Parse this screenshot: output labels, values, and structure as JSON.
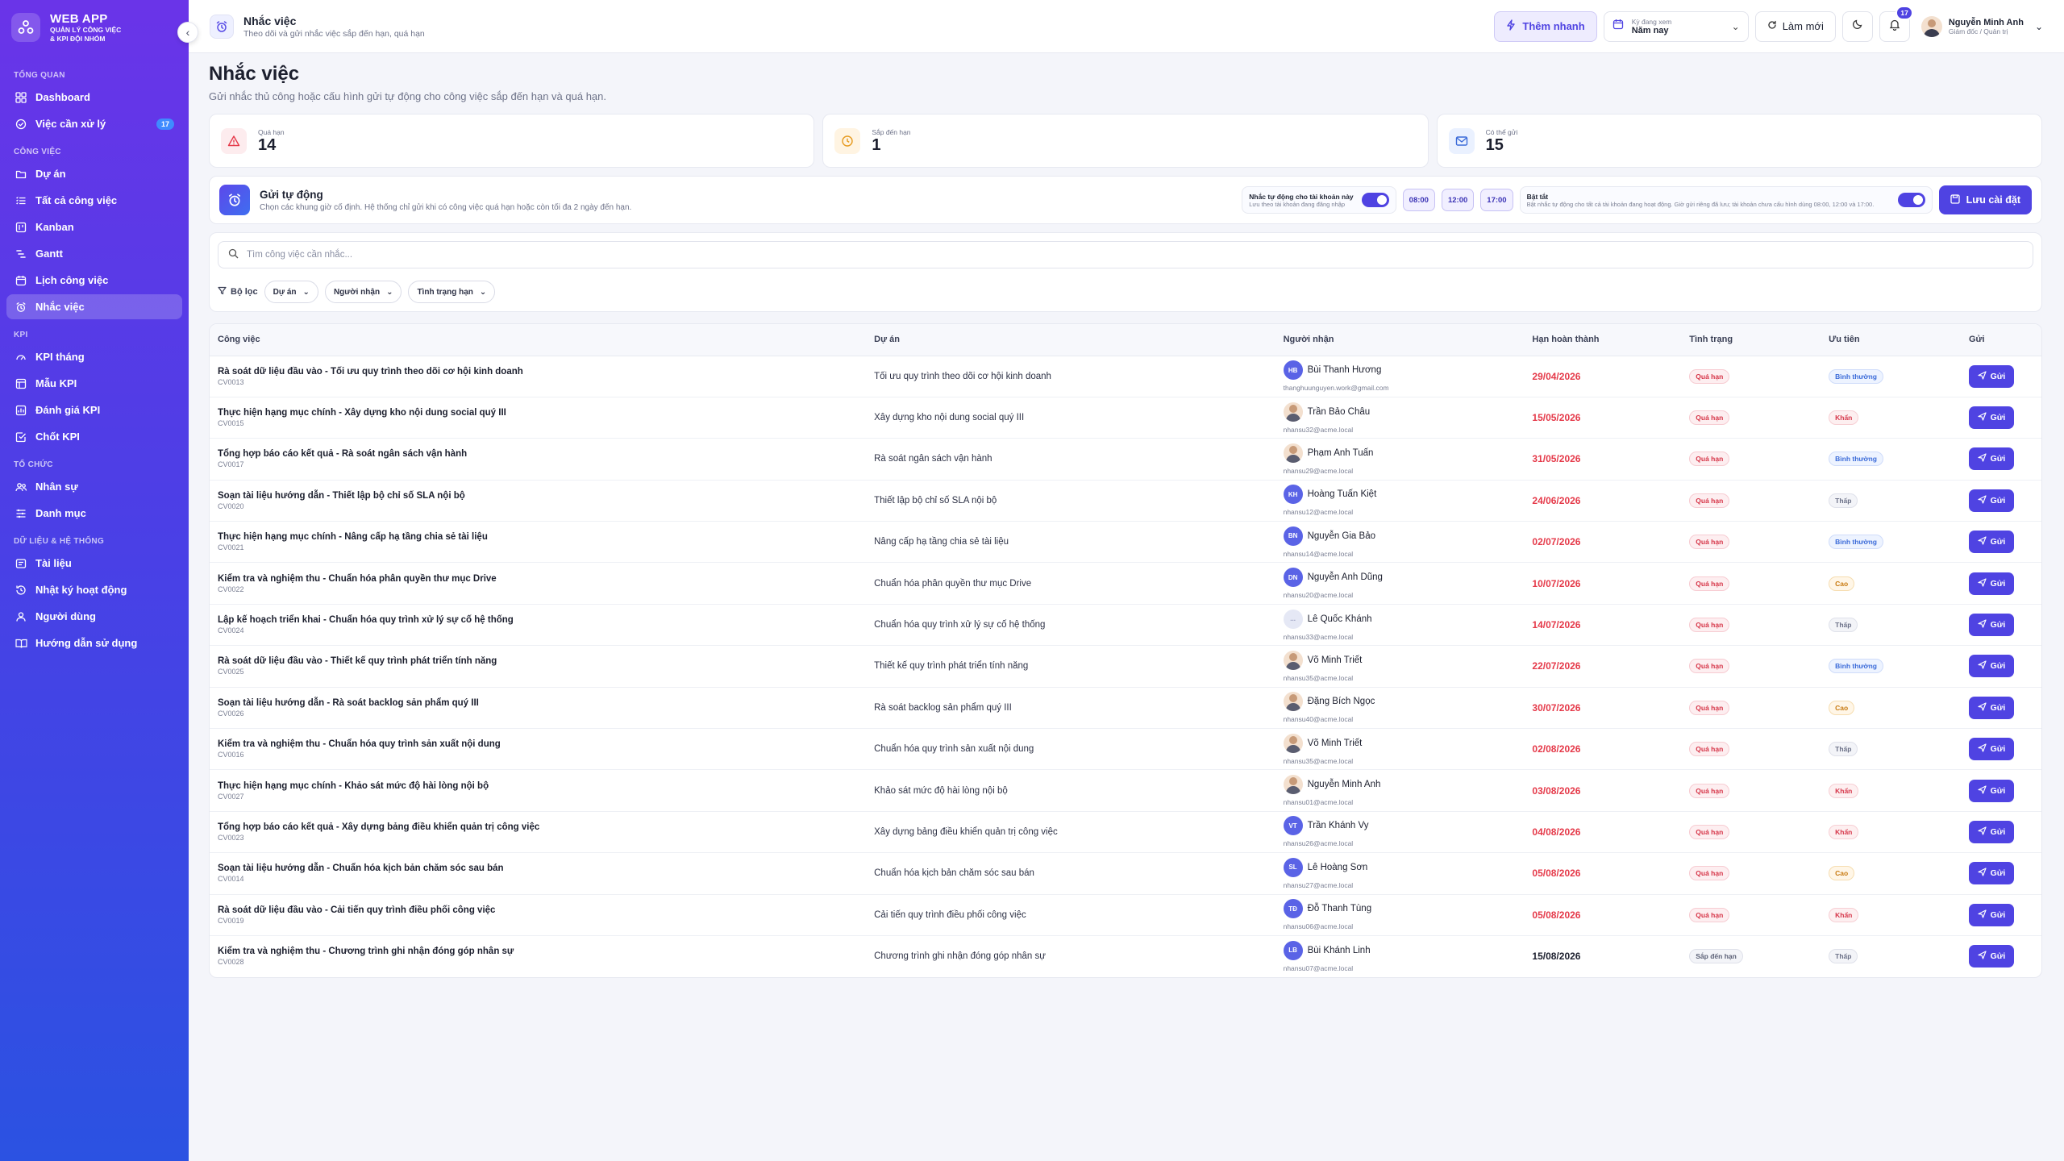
{
  "brand": {
    "title": "WEB APP",
    "subtitle_line1": "QUẢN LÝ CÔNG VIỆC",
    "subtitle_line2": "& KPI ĐỘI NHÓM"
  },
  "sidebar": {
    "sections": [
      {
        "title": "TỔNG QUAN",
        "items": [
          {
            "label": "Dashboard",
            "icon": "dashboard-icon"
          },
          {
            "label": "Việc cần xử lý",
            "icon": "check-circle-icon",
            "badge": "17"
          }
        ]
      },
      {
        "title": "CÔNG VIỆC",
        "items": [
          {
            "label": "Dự án",
            "icon": "folder-icon"
          },
          {
            "label": "Tất cả công việc",
            "icon": "list-icon"
          },
          {
            "label": "Kanban",
            "icon": "kanban-icon"
          },
          {
            "label": "Gantt",
            "icon": "gantt-icon"
          },
          {
            "label": "Lịch công việc",
            "icon": "calendar-icon"
          },
          {
            "label": "Nhắc việc",
            "icon": "alarm-icon",
            "active": true
          }
        ]
      },
      {
        "title": "KPI",
        "items": [
          {
            "label": "KPI tháng",
            "icon": "gauge-icon"
          },
          {
            "label": "Mẫu KPI",
            "icon": "template-icon"
          },
          {
            "label": "Đánh giá KPI",
            "icon": "rating-icon"
          },
          {
            "label": "Chốt KPI",
            "icon": "check-square-icon"
          }
        ]
      },
      {
        "title": "TỔ CHỨC",
        "items": [
          {
            "label": "Nhân sự",
            "icon": "users-icon"
          },
          {
            "label": "Danh mục",
            "icon": "category-icon"
          }
        ]
      },
      {
        "title": "DỮ LIỆU & HỆ THỐNG",
        "items": [
          {
            "label": "Tài liệu",
            "icon": "document-icon"
          },
          {
            "label": "Nhật ký hoạt động",
            "icon": "history-icon"
          },
          {
            "label": "Người dùng",
            "icon": "user-icon"
          },
          {
            "label": "Hướng dẫn sử dụng",
            "icon": "book-icon"
          }
        ]
      }
    ]
  },
  "topbar": {
    "title": "Nhắc việc",
    "subtitle": "Theo dõi và gửi nhắc việc sắp đến hạn, quá hạn",
    "quick_add": "Thêm nhanh",
    "period_label": "Kỳ đang xem",
    "period_value": "Năm nay",
    "refresh": "Làm mới",
    "notif_count": "17",
    "user_name": "Nguyễn Minh Anh",
    "user_role": "Giám đốc / Quản trị"
  },
  "page": {
    "title": "Nhắc việc",
    "subtitle": "Gửi nhắc thủ công hoặc cấu hình gửi tự động cho công việc sắp đến hạn và quá hạn."
  },
  "stats": [
    {
      "label": "Quá hạn",
      "value": "14",
      "icon": "warning-icon",
      "color": "#e53949",
      "bg": "#fdecee"
    },
    {
      "label": "Sắp đến hạn",
      "value": "1",
      "icon": "clock-icon",
      "color": "#e69a1e",
      "bg": "#fff4e2"
    },
    {
      "label": "Có thể gửi",
      "value": "15",
      "icon": "mail-icon",
      "color": "#3b6bd9",
      "bg": "#eaf1ff"
    }
  ],
  "auto_send": {
    "title": "Gửi tự động",
    "desc": "Chọn các khung giờ cố định. Hệ thống chỉ gửi khi có công việc quá hạn hoặc còn tối đa 2 ngày đến hạn.",
    "account_toggle_title": "Nhắc tự động cho tài khoản này",
    "account_toggle_desc": "Lưu theo tài khoản đang đăng nhập",
    "times": [
      "08:00",
      "12:00",
      "17:00"
    ],
    "global_toggle_title": "Bật tắt",
    "global_toggle_desc": "Bật nhắc tự động cho tất cả tài khoản đang hoạt động. Giờ gửi riêng đã lưu; tài khoản chưa cấu hình dùng 08:00, 12:00 và 17:00.",
    "save": "Lưu cài đặt"
  },
  "search": {
    "placeholder": "Tìm công việc cần nhắc..."
  },
  "filters": {
    "label": "Bộ lọc",
    "project": "Dự án",
    "receiver": "Người nhận",
    "due_status": "Tình trạng hạn"
  },
  "table": {
    "headers": [
      "Công việc",
      "Dự án",
      "Người nhận",
      "Hạn hoàn thành",
      "Tình trạng",
      "Ưu tiên",
      "Gửi"
    ],
    "send_label": "Gửi",
    "rows": [
      {
        "task": "Rà soát dữ liệu đầu vào - Tối ưu quy trình theo dõi cơ hội kinh doanh",
        "code": "CV0013",
        "project": "Tối ưu quy trình theo dõi cơ hội kinh doanh",
        "initials": "HB",
        "avatar": "initials",
        "receiver": "Bùi Thanh Hương",
        "email": "thanghuunguyen.work@gmail.com",
        "due": "29/04/2026",
        "due_color": "red",
        "status": "Quá hạn",
        "status_kind": "qh",
        "priority": "Bình thường",
        "priority_kind": "bt"
      },
      {
        "task": "Thực hiện hạng mục chính - Xây dựng kho nội dung social quý III",
        "code": "CV0015",
        "project": "Xây dựng kho nội dung social quý III",
        "initials": "",
        "avatar": "photo",
        "receiver": "Trần Bảo Châu",
        "email": "nhansu32@acme.local",
        "due": "15/05/2026",
        "due_color": "red",
        "status": "Quá hạn",
        "status_kind": "qh",
        "priority": "Khẩn",
        "priority_kind": "kh"
      },
      {
        "task": "Tổng hợp báo cáo kết quả - Rà soát ngân sách vận hành",
        "code": "CV0017",
        "project": "Rà soát ngân sách vận hành",
        "initials": "",
        "avatar": "photo",
        "receiver": "Phạm Anh Tuấn",
        "email": "nhansu29@acme.local",
        "due": "31/05/2026",
        "due_color": "red",
        "status": "Quá hạn",
        "status_kind": "qh",
        "priority": "Bình thường",
        "priority_kind": "bt"
      },
      {
        "task": "Soạn tài liệu hướng dẫn - Thiết lập bộ chỉ số SLA nội bộ",
        "code": "CV0020",
        "project": "Thiết lập bộ chỉ số SLA nội bộ",
        "initials": "KH",
        "avatar": "initials",
        "receiver": "Hoàng Tuấn Kiệt",
        "email": "nhansu12@acme.local",
        "due": "24/06/2026",
        "due_color": "red",
        "status": "Quá hạn",
        "status_kind": "qh",
        "priority": "Thấp",
        "priority_kind": "th"
      },
      {
        "task": "Thực hiện hạng mục chính - Nâng cấp hạ tầng chia sẻ tài liệu",
        "code": "CV0021",
        "project": "Nâng cấp hạ tầng chia sẻ tài liệu",
        "initials": "BN",
        "avatar": "initials",
        "receiver": "Nguyễn Gia Bảo",
        "email": "nhansu14@acme.local",
        "due": "02/07/2026",
        "due_color": "red",
        "status": "Quá hạn",
        "status_kind": "qh",
        "priority": "Bình thường",
        "priority_kind": "bt"
      },
      {
        "task": "Kiểm tra và nghiệm thu - Chuẩn hóa phân quyền thư mục Drive",
        "code": "CV0022",
        "project": "Chuẩn hóa phân quyền thư mục Drive",
        "initials": "DN",
        "avatar": "initials",
        "receiver": "Nguyễn Anh Dũng",
        "email": "nhansu20@acme.local",
        "due": "10/07/2026",
        "due_color": "red",
        "status": "Quá hạn",
        "status_kind": "qh",
        "priority": "Cao",
        "priority_kind": "cao"
      },
      {
        "task": "Lập kế hoạch triển khai - Chuẩn hóa quy trình xử lý sự cố hệ thống",
        "code": "CV0024",
        "project": "Chuẩn hóa quy trình xử lý sự cố hệ thống",
        "initials": "...",
        "avatar": "pale",
        "receiver": "Lê Quốc Khánh",
        "email": "nhansu33@acme.local",
        "due": "14/07/2026",
        "due_color": "red",
        "status": "Quá hạn",
        "status_kind": "qh",
        "priority": "Thấp",
        "priority_kind": "th"
      },
      {
        "task": "Rà soát dữ liệu đầu vào - Thiết kế quy trình phát triển tính năng",
        "code": "CV0025",
        "project": "Thiết kế quy trình phát triển tính năng",
        "initials": "",
        "avatar": "photo",
        "receiver": "Võ Minh Triết",
        "email": "nhansu35@acme.local",
        "due": "22/07/2026",
        "due_color": "red",
        "status": "Quá hạn",
        "status_kind": "qh",
        "priority": "Bình thường",
        "priority_kind": "bt"
      },
      {
        "task": "Soạn tài liệu hướng dẫn - Rà soát backlog sản phẩm quý III",
        "code": "CV0026",
        "project": "Rà soát backlog sản phẩm quý III",
        "initials": "",
        "avatar": "photo",
        "receiver": "Đặng Bích Ngọc",
        "email": "nhansu40@acme.local",
        "due": "30/07/2026",
        "due_color": "red",
        "status": "Quá hạn",
        "status_kind": "qh",
        "priority": "Cao",
        "priority_kind": "cao"
      },
      {
        "task": "Kiểm tra và nghiệm thu - Chuẩn hóa quy trình sản xuất nội dung",
        "code": "CV0016",
        "project": "Chuẩn hóa quy trình sản xuất nội dung",
        "initials": "",
        "avatar": "photo",
        "receiver": "Võ Minh Triết",
        "email": "nhansu35@acme.local",
        "due": "02/08/2026",
        "due_color": "red",
        "status": "Quá hạn",
        "status_kind": "qh",
        "priority": "Thấp",
        "priority_kind": "th"
      },
      {
        "task": "Thực hiện hạng mục chính - Khảo sát mức độ hài lòng nội bộ",
        "code": "CV0027",
        "project": "Khảo sát mức độ hài lòng nội bộ",
        "initials": "",
        "avatar": "photo",
        "receiver": "Nguyễn Minh Anh",
        "email": "nhansu01@acme.local",
        "due": "03/08/2026",
        "due_color": "red",
        "status": "Quá hạn",
        "status_kind": "qh",
        "priority": "Khẩn",
        "priority_kind": "kh"
      },
      {
        "task": "Tổng hợp báo cáo kết quả - Xây dựng bảng điều khiển quản trị công việc",
        "code": "CV0023",
        "project": "Xây dựng bảng điều khiển quản trị công việc",
        "initials": "VT",
        "avatar": "initials",
        "receiver": "Trần Khánh Vy",
        "email": "nhansu26@acme.local",
        "due": "04/08/2026",
        "due_color": "red",
        "status": "Quá hạn",
        "status_kind": "qh",
        "priority": "Khẩn",
        "priority_kind": "kh"
      },
      {
        "task": "Soạn tài liệu hướng dẫn - Chuẩn hóa kịch bản chăm sóc sau bán",
        "code": "CV0014",
        "project": "Chuẩn hóa kịch bản chăm sóc sau bán",
        "initials": "SL",
        "avatar": "initials",
        "receiver": "Lê Hoàng Sơn",
        "email": "nhansu27@acme.local",
        "due": "05/08/2026",
        "due_color": "red",
        "status": "Quá hạn",
        "status_kind": "qh",
        "priority": "Cao",
        "priority_kind": "cao"
      },
      {
        "task": "Rà soát dữ liệu đầu vào - Cải tiến quy trình điều phối công việc",
        "code": "CV0019",
        "project": "Cải tiến quy trình điều phối công việc",
        "initials": "TĐ",
        "avatar": "initials",
        "receiver": "Đỗ Thanh Tùng",
        "email": "nhansu06@acme.local",
        "due": "05/08/2026",
        "due_color": "red",
        "status": "Quá hạn",
        "status_kind": "qh",
        "priority": "Khẩn",
        "priority_kind": "kh"
      },
      {
        "task": "Kiểm tra và nghiệm thu - Chương trình ghi nhận đóng góp nhân sự",
        "code": "CV0028",
        "project": "Chương trình ghi nhận đóng góp nhân sự",
        "initials": "LB",
        "avatar": "initials",
        "receiver": "Bùi Khánh Linh",
        "email": "nhansu07@acme.local",
        "due": "15/08/2026",
        "due_color": "dark",
        "status": "Sắp đến hạn",
        "status_kind": "sdh",
        "priority": "Thấp",
        "priority_kind": "th"
      }
    ]
  }
}
